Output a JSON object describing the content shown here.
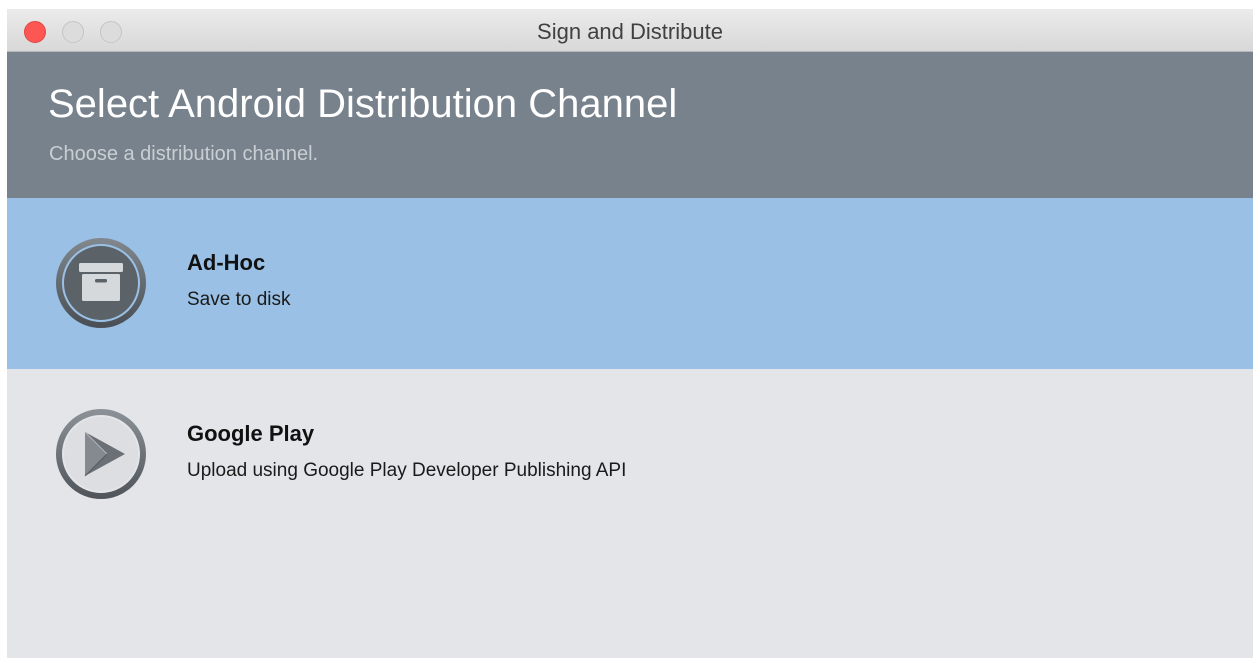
{
  "window": {
    "title": "Sign and Distribute"
  },
  "header": {
    "title": "Select Android Distribution Channel",
    "subtitle": "Choose a distribution channel."
  },
  "channels": [
    {
      "name": "Ad-Hoc",
      "description": "Save to disk",
      "icon": "archive-box-icon",
      "selected": true
    },
    {
      "name": "Google Play",
      "description": "Upload using Google Play Developer Publishing API",
      "icon": "play-icon",
      "selected": false
    }
  ],
  "colors": {
    "header_bg": "#77828c",
    "selected_bg": "#9ac1e5",
    "list_bg": "#e3e5e8",
    "close_button": "#fc5753"
  }
}
